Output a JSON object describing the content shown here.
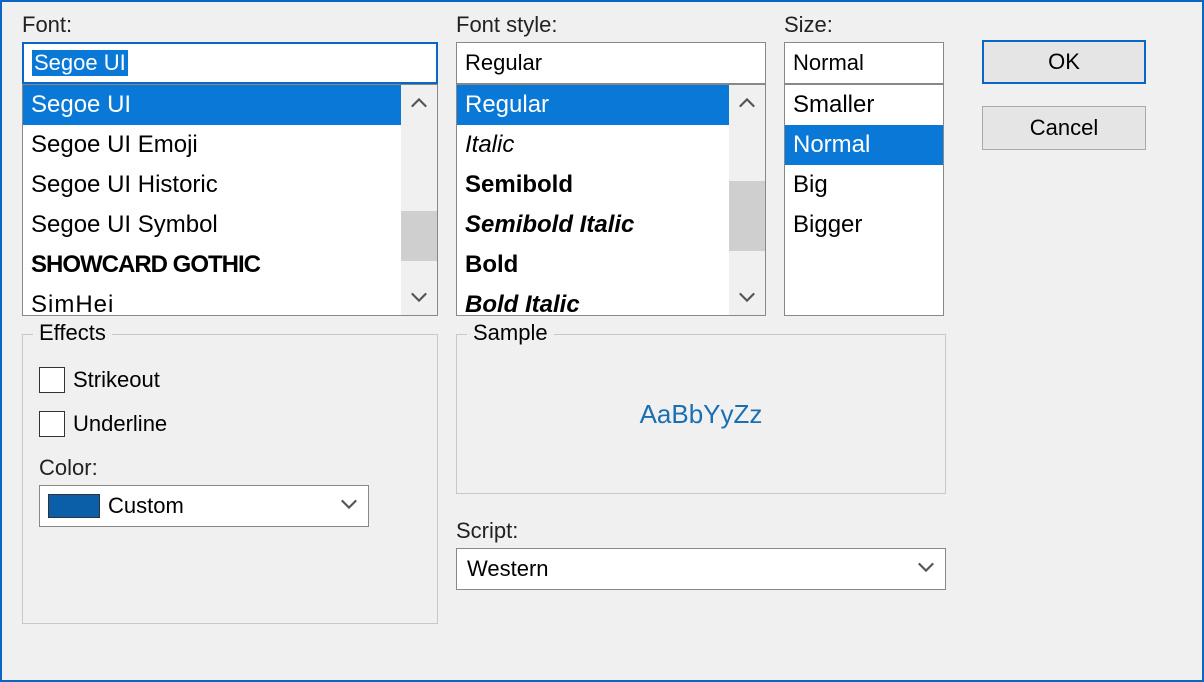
{
  "font": {
    "label": "Font:",
    "value": "Segoe UI",
    "items": [
      "Segoe UI",
      "Segoe UI Emoji",
      "Segoe UI Historic",
      "Segoe UI Symbol",
      "SHOWCARD GOTHIC",
      "SimHei"
    ],
    "selected": "Segoe UI"
  },
  "fontstyle": {
    "label": "Font style:",
    "value": "Regular",
    "items": [
      "Regular",
      "Italic",
      "Semibold",
      "Semibold Italic",
      "Bold",
      "Bold Italic"
    ],
    "selected": "Regular"
  },
  "size": {
    "label": "Size:",
    "value": "Normal",
    "items": [
      "Smaller",
      "Normal",
      "Big",
      "Bigger"
    ],
    "selected": "Normal"
  },
  "buttons": {
    "ok": "OK",
    "cancel": "Cancel"
  },
  "effects": {
    "legend": "Effects",
    "strikeout": "Strikeout",
    "underline": "Underline",
    "color_label": "Color:",
    "color_value": "Custom",
    "color_swatch": "#0b5ea8"
  },
  "sample": {
    "legend": "Sample",
    "text": "AaBbYyZz"
  },
  "script": {
    "label": "Script:",
    "value": "Western"
  }
}
